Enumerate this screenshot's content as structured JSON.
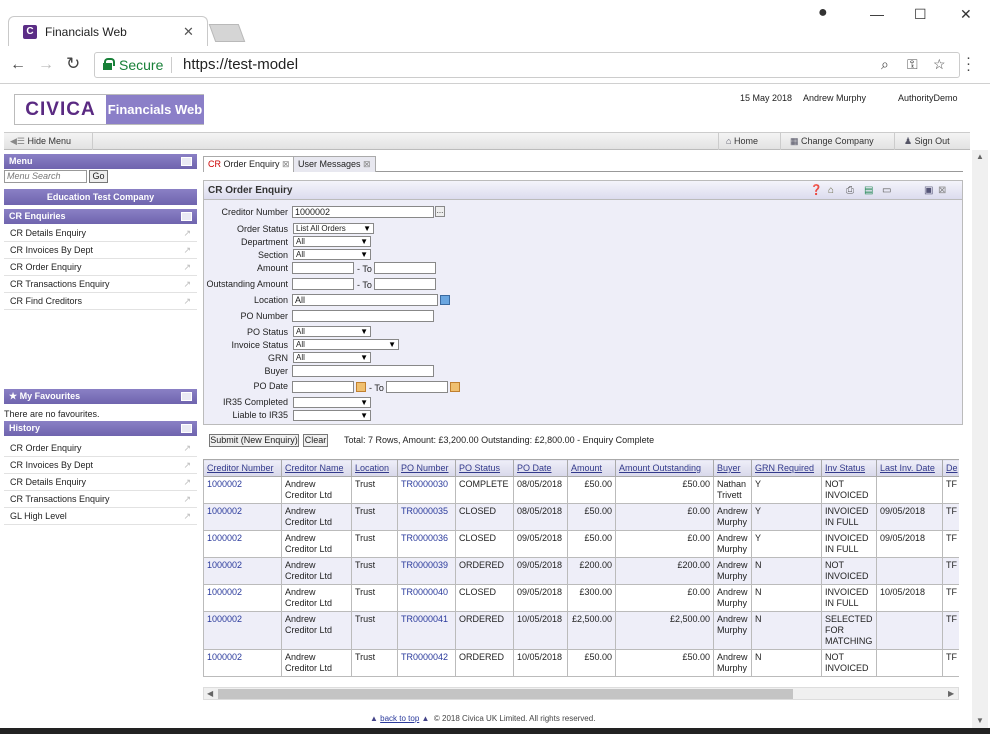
{
  "browser": {
    "tab_title": "Financials Web",
    "secure_label": "Secure",
    "url": "https://test-model"
  },
  "header": {
    "logo_civica": "CIVICA",
    "logo_product": "Financials Web",
    "date": "15 May 2018",
    "user": "Andrew Murphy",
    "authority": "AuthorityDemo"
  },
  "toolbar": {
    "hide_menu": "Hide Menu",
    "home": "Home",
    "change_company": "Change Company",
    "sign_out": "Sign Out"
  },
  "menu": {
    "title": "Menu",
    "search_placeholder": "Menu Search",
    "go": "Go",
    "company": "Education Test Company",
    "section_title": "CR Enquiries",
    "items": [
      "CR Details Enquiry",
      "CR Invoices By Dept",
      "CR Order Enquiry",
      "CR Transactions Enquiry",
      "CR Find Creditors"
    ]
  },
  "favourites": {
    "title": "My Favourites",
    "empty": "There are no favourites."
  },
  "history": {
    "title": "History",
    "items": [
      "CR Order Enquiry",
      "CR Invoices By Dept",
      "CR Details Enquiry",
      "CR Transactions Enquiry",
      "GL High Level"
    ]
  },
  "tabs": {
    "active_prefix": "CR",
    "active_rest": " Order Enquiry",
    "second": "User Messages"
  },
  "form": {
    "title": "CR Order Enquiry",
    "labels": {
      "creditor_number": "Creditor Number",
      "order_status": "Order Status",
      "department": "Department",
      "section": "Section",
      "amount": "Amount",
      "outstanding_amount": "Outstanding Amount",
      "location": "Location",
      "po_number": "PO Number",
      "po_status": "PO Status",
      "invoice_status": "Invoice Status",
      "grn": "GRN",
      "buyer": "Buyer",
      "po_date": "PO Date",
      "ir35_completed": "IR35 Completed",
      "liable_ir35": "Liable to IR35",
      "to": "- To"
    },
    "values": {
      "creditor_number": "1000002",
      "order_status": "List All Orders",
      "department": "All",
      "section": "All",
      "location": "All",
      "po_status": "All",
      "invoice_status": "All",
      "grn": "All"
    },
    "submit": "Submit (New Enquiry)",
    "clear": "Clear",
    "summary": "Total: 7 Rows, Amount: £3,200.00 Outstanding: £2,800.00 - Enquiry Complete"
  },
  "table": {
    "columns": [
      "Creditor Number",
      "Creditor Name",
      "Location",
      "PO Number",
      "PO Status",
      "PO Date",
      "Amount",
      "Amount Outstanding",
      "Buyer",
      "GRN Required",
      "Inv Status",
      "Last Inv. Date",
      "De"
    ],
    "rows": [
      [
        "1000002",
        "Andrew Creditor Ltd",
        "Trust",
        "TR0000030",
        "COMPLETE",
        "08/05/2018",
        "£50.00",
        "£50.00",
        "Nathan Trivett",
        "Y",
        "NOT INVOICED",
        "",
        "TF"
      ],
      [
        "1000002",
        "Andrew Creditor Ltd",
        "Trust",
        "TR0000035",
        "CLOSED",
        "08/05/2018",
        "£50.00",
        "£0.00",
        "Andrew Murphy",
        "Y",
        "INVOICED IN FULL",
        "09/05/2018",
        "TF"
      ],
      [
        "1000002",
        "Andrew Creditor Ltd",
        "Trust",
        "TR0000036",
        "CLOSED",
        "09/05/2018",
        "£50.00",
        "£0.00",
        "Andrew Murphy",
        "Y",
        "INVOICED IN FULL",
        "09/05/2018",
        "TF"
      ],
      [
        "1000002",
        "Andrew Creditor Ltd",
        "Trust",
        "TR0000039",
        "ORDERED",
        "09/05/2018",
        "£200.00",
        "£200.00",
        "Andrew Murphy",
        "N",
        "NOT INVOICED",
        "",
        "TF"
      ],
      [
        "1000002",
        "Andrew Creditor Ltd",
        "Trust",
        "TR0000040",
        "CLOSED",
        "09/05/2018",
        "£300.00",
        "£0.00",
        "Andrew Murphy",
        "N",
        "INVOICED IN FULL",
        "10/05/2018",
        "TF"
      ],
      [
        "1000002",
        "Andrew Creditor Ltd",
        "Trust",
        "TR0000041",
        "ORDERED",
        "10/05/2018",
        "£2,500.00",
        "£2,500.00",
        "Andrew Murphy",
        "N",
        "SELECTED FOR MATCHING",
        "",
        "TF"
      ],
      [
        "1000002",
        "Andrew Creditor Ltd",
        "Trust",
        "TR0000042",
        "ORDERED",
        "10/05/2018",
        "£50.00",
        "£50.00",
        "Andrew Murphy",
        "N",
        "NOT INVOICED",
        "",
        "TF"
      ]
    ]
  },
  "footer": {
    "back_to_top": "back to top",
    "copyright": "© 2018 Civica UK Limited. All rights reserved."
  }
}
